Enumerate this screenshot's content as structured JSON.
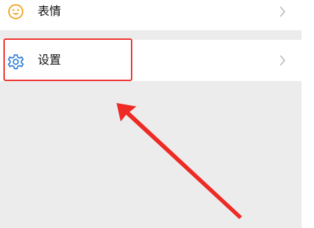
{
  "rows": [
    {
      "label": "表情",
      "icon": "smiley-icon"
    },
    {
      "label": "设置",
      "icon": "gear-icon"
    }
  ],
  "colors": {
    "icon_emoji": "#f2a52a",
    "icon_gear": "#2f7fd6",
    "highlight": "#ee2a24",
    "arrow": "#ee2a24",
    "background": "#ececec",
    "row_background": "#ffffff",
    "chevron": "#b5b5b5"
  }
}
